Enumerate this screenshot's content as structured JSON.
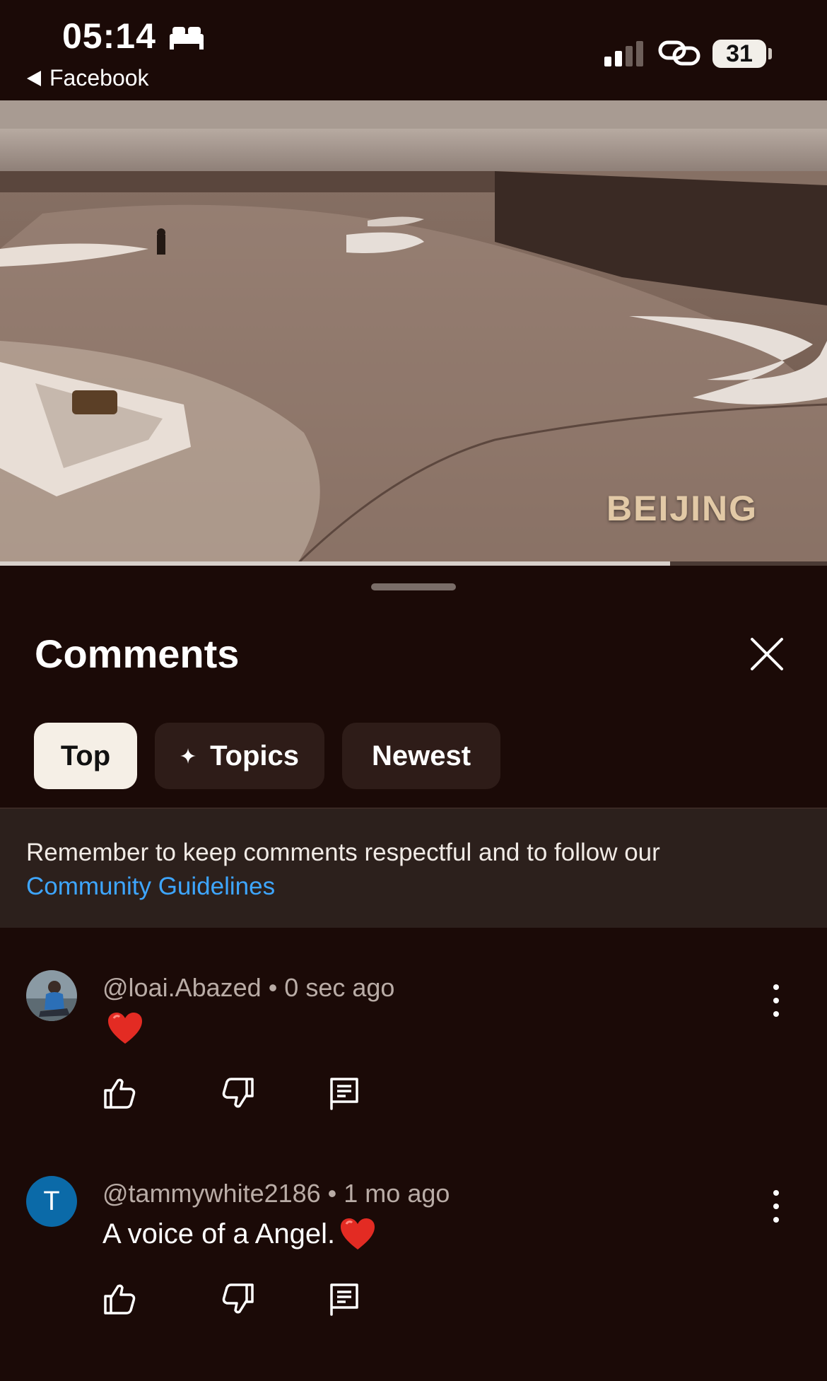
{
  "status_bar": {
    "time": "05:14",
    "back_app": "Facebook",
    "battery": "31"
  },
  "video": {
    "caption": "BEIJING",
    "progress": 0.81
  },
  "comments_panel": {
    "title": "Comments",
    "chips": [
      {
        "label": "Top",
        "active": true
      },
      {
        "label": "Topics",
        "active": false,
        "icon": "sparkle-icon"
      },
      {
        "label": "Newest",
        "active": false
      }
    ],
    "notice": {
      "text": "Remember to keep comments respectful and to follow our",
      "link": "Community Guidelines"
    }
  },
  "comments": [
    {
      "author": "@loai.Abazed",
      "time": "0 sec ago",
      "text": "",
      "emoji": "heart-emoji"
    },
    {
      "author": "@tammywhite2186",
      "time": "1 mo ago",
      "avatar_letter": "T",
      "text": "A voice of a Angel.",
      "emoji": "heart-emoji"
    }
  ],
  "colors": {
    "background": "#1b0a07",
    "link": "#3ea6ff",
    "chip_active": "#f5efe6",
    "avatar_blue": "#0b6aa8"
  }
}
